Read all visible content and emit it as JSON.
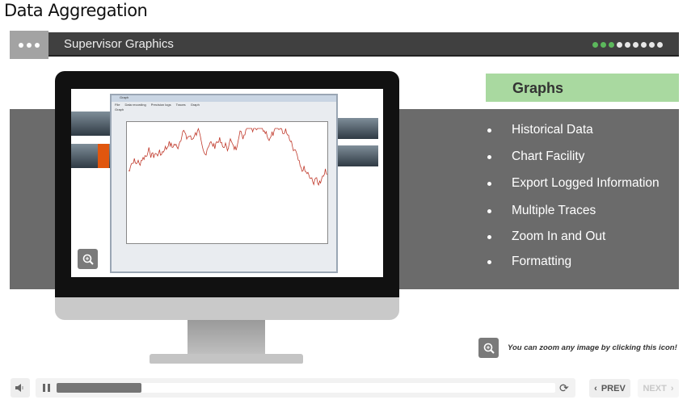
{
  "page_title": "Data Aggregation",
  "header": {
    "title": "Supervisor Graphics",
    "progress_dots": {
      "total": 9,
      "completed": 3,
      "active_color": "#5cb85c",
      "inactive_color": "#e6e6e6"
    }
  },
  "slide": {
    "heading": "Graphs",
    "heading_bg": "#a9d9a0",
    "bullets": [
      "Historical Data",
      "Chart Facility",
      "Export Logged Information",
      "Multiple Traces",
      "Zoom In and Out",
      "Formatting"
    ],
    "zoom_hint": "You can zoom any image by clicking this icon!",
    "image": {
      "window_title": "Graph",
      "menu": [
        "File",
        "Data recording",
        "Precision logs",
        "Traces",
        "Graph"
      ],
      "tab": "Graph",
      "trace_color": "#c0392b"
    }
  },
  "player": {
    "progress_percent": 17,
    "prev_label": "PREV",
    "next_label": "NEXT",
    "next_enabled": false
  }
}
